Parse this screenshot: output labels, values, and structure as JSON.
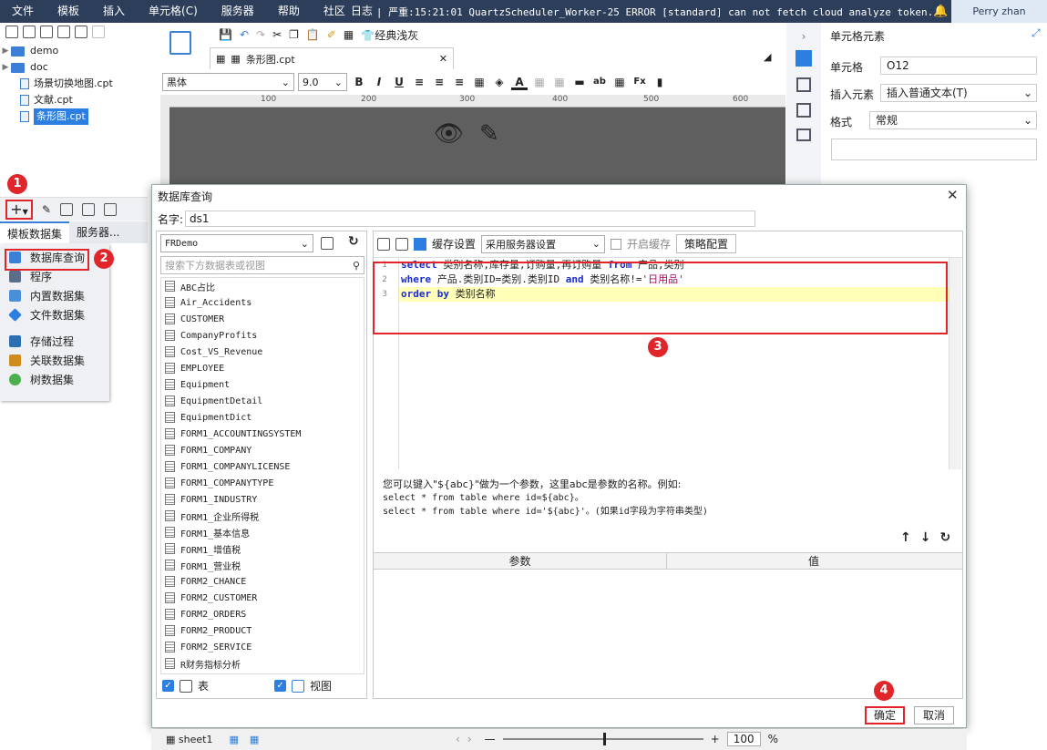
{
  "menu": {
    "items": [
      "文件",
      "模板",
      "插入",
      "单元格(C)",
      "服务器",
      "帮助",
      "社区",
      "日志"
    ],
    "log_text": "| 严重:15:21:01 QuartzScheduler_Worker-25 ERROR [standard] can not fetch cloud analyze token.",
    "user": "Perry zhan"
  },
  "tree": {
    "items": [
      {
        "label": "demo",
        "type": "folder"
      },
      {
        "label": "doc",
        "type": "folder"
      },
      {
        "label": "场景切换地图.cpt",
        "type": "file"
      },
      {
        "label": "文献.cpt",
        "type": "file"
      },
      {
        "label": "条形图.cpt",
        "type": "file",
        "selected": true
      }
    ]
  },
  "dataset_tabs": [
    "模板数据集",
    "服务器..."
  ],
  "dataset_menu": [
    {
      "label": "数据库查询",
      "color": "#3b7fd6"
    },
    {
      "label": "程序",
      "color": "#5a6e8a"
    },
    {
      "label": "内置数据集",
      "color": "#4a90d9"
    },
    {
      "label": "文件数据集",
      "color": "#2c7fe0"
    },
    {
      "label": "存储过程",
      "color": "#2c6fb0"
    },
    {
      "label": "关联数据集",
      "color": "#d08b1e"
    },
    {
      "label": "树数据集",
      "color": "#4caf50"
    }
  ],
  "editor": {
    "theme_label": "经典浅灰",
    "file_tab": "条形图.cpt",
    "font": "黑体",
    "font_size": "9.0",
    "ruler_ticks": [
      "100",
      "200",
      "300",
      "400",
      "500",
      "600"
    ]
  },
  "right_panel": {
    "title": "单元格元素",
    "cell_label": "单元格",
    "cell_value": "O12",
    "insert_label": "插入元素",
    "insert_value": "插入普通文本(T)",
    "format_label": "格式",
    "format_value": "常规"
  },
  "dialog": {
    "title": "数据库查询",
    "name_label": "名字:",
    "name_value": "ds1",
    "connection": "FRDemo",
    "search_placeholder": "搜索下方数据表或视图",
    "tables": [
      "ABC占比",
      "Air_Accidents",
      "CUSTOMER",
      "CompanyProfits",
      "Cost_VS_Revenue",
      "EMPLOYEE",
      "Equipment",
      "EquipmentDetail",
      "EquipmentDict",
      "FORM1_ACCOUNTINGSYSTEM",
      "FORM1_COMPANY",
      "FORM1_COMPANYLICENSE",
      "FORM1_COMPANYTYPE",
      "FORM1_INDUSTRY",
      "FORM1_企业所得税",
      "FORM1_基本信息",
      "FORM1_增值税",
      "FORM1_营业税",
      "FORM2_CHANCE",
      "FORM2_CUSTOMER",
      "FORM2_ORDERS",
      "FORM2_PRODUCT",
      "FORM2_SERVICE",
      "R财务指标分析"
    ],
    "check_table": "表",
    "check_view": "视图",
    "cache_label": "缓存设置",
    "cache_value": "采用服务器设置",
    "enable_cache": "开启缓存",
    "strategy": "策略配置",
    "sql": {
      "line1": {
        "kw1": "select",
        "t1": " 类别名称,库存量,订购量,再订购量 ",
        "kw2": "from",
        "t2": " 产品,类别"
      },
      "line2": {
        "kw1": "where",
        "t1": " 产品.类别ID=类别.类别ID ",
        "kw2": "and",
        "t2": " 类别名称!=",
        "str": "'日用品'"
      },
      "line3": {
        "kw1": "order by",
        "t1": " 类别名称"
      }
    },
    "hint": {
      "line1": "您可以键入\"${abc}\"做为一个参数，这里abc是参数的名称。例如:",
      "line2": "select * from table where id=${abc}。",
      "line3": "select * from table where id='${abc}'。(如果id字段为字符串类型)"
    },
    "param_header": "参数",
    "value_header": "值",
    "ok": "确定",
    "cancel": "取消"
  },
  "badges": [
    "1",
    "2",
    "3",
    "4"
  ],
  "bottom": {
    "sheet": "sheet1",
    "zoom": "100",
    "percent": "%"
  }
}
